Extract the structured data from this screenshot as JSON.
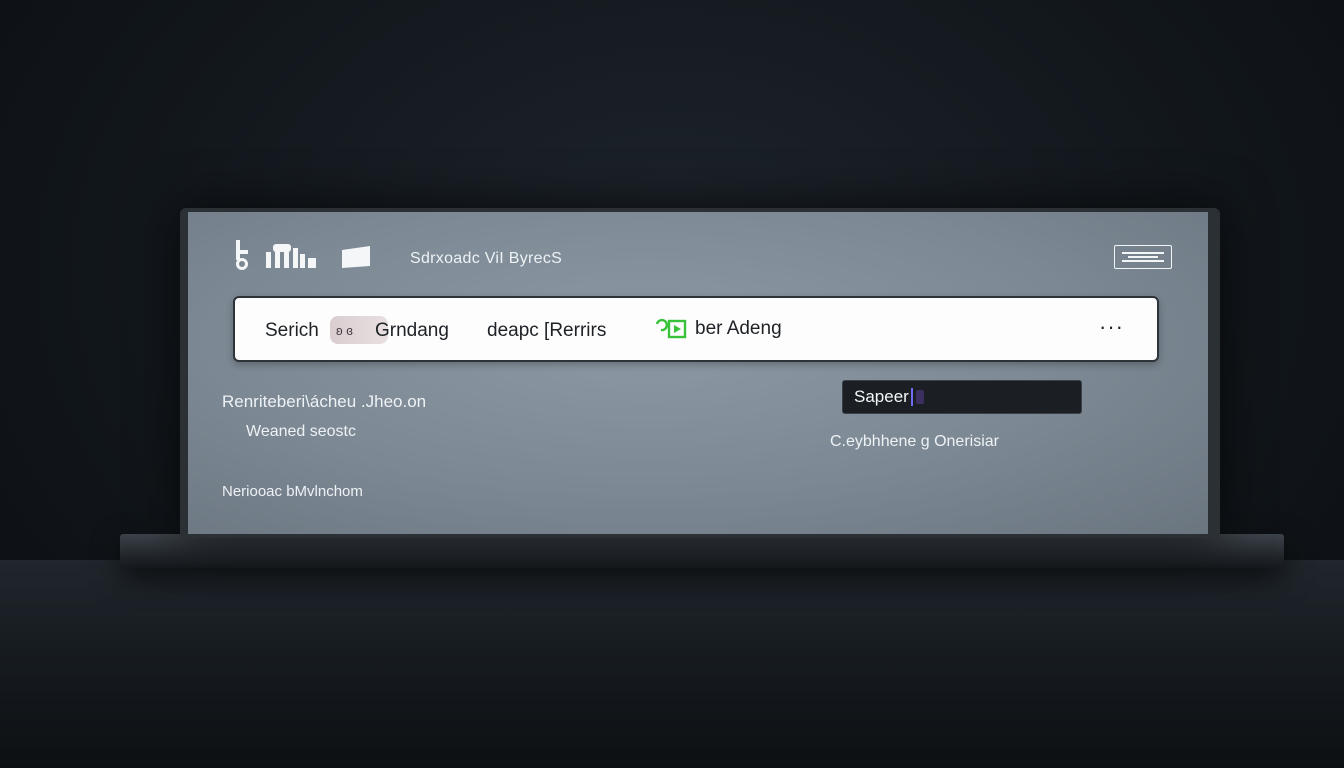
{
  "window": {
    "title": "Sdrxoadc ViI ByrecS"
  },
  "search": {
    "label": "Serich",
    "pill_text": "ʚ ɞ",
    "term": "Grndang",
    "filter": "deapc [Rerrirs",
    "status": "ber Adeng",
    "more": "···"
  },
  "results": {
    "title": "Renriteberi\\ácheu .Jheo.on",
    "subtitle": "Weaned seostc",
    "footer": "Neriooac bMvlnchom"
  },
  "side_panel": {
    "input_value": "Sapeer",
    "note": "C.eybhhene g Onerisiar"
  },
  "colors": {
    "screen": "#7c8893",
    "status_icon": "#37c23a",
    "caret": "#6f6cf2",
    "input_bg": "#1b1f24"
  },
  "icons": [
    "toolbar-key-icon",
    "toolbar-people-icon",
    "toolbar-flag-icon",
    "window-toggle-icon",
    "status-play-icon",
    "more-icon"
  ]
}
